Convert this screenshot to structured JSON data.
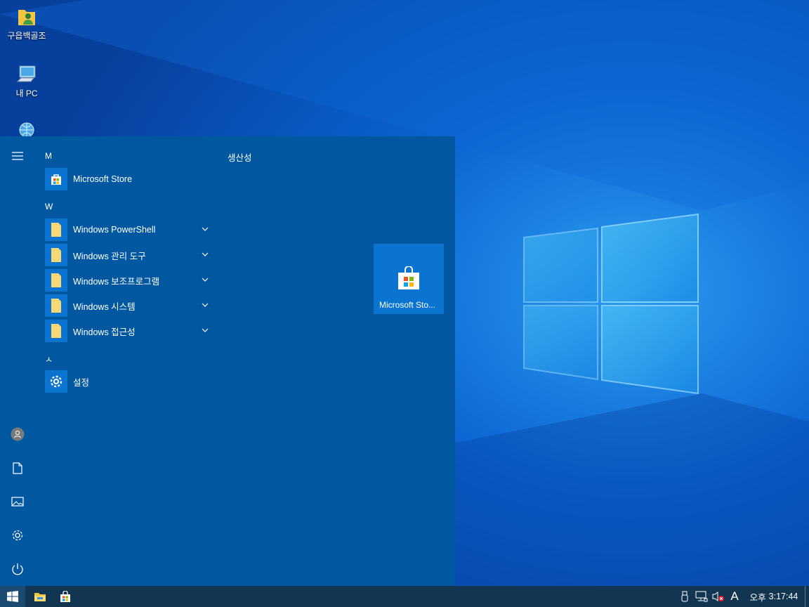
{
  "desktop": {
    "icons": [
      {
        "label": "구읍백골조",
        "icon": "user-folder-icon"
      },
      {
        "label": "내 PC",
        "icon": "computer-icon"
      },
      {
        "label": "",
        "icon": "network-globe-icon"
      }
    ]
  },
  "start_menu": {
    "groups": [
      {
        "letter": "M",
        "apps": [
          {
            "label": "Microsoft Store",
            "icon": "store-icon",
            "expandable": false
          }
        ]
      },
      {
        "letter": "W",
        "apps": [
          {
            "label": "Windows PowerShell",
            "icon": "folder-icon",
            "expandable": true
          },
          {
            "label": "Windows 관리 도구",
            "icon": "folder-icon",
            "expandable": true
          },
          {
            "label": "Windows 보조프로그램",
            "icon": "folder-icon",
            "expandable": true
          },
          {
            "label": "Windows 시스템",
            "icon": "folder-icon",
            "expandable": true
          },
          {
            "label": "Windows 접근성",
            "icon": "folder-icon",
            "expandable": true
          }
        ]
      },
      {
        "letter": "ㅅ",
        "apps": [
          {
            "label": "설정",
            "icon": "gear-icon",
            "expandable": false
          }
        ]
      }
    ],
    "tiles_header": "생산성",
    "tiles": [
      {
        "label": "Microsoft Sto...",
        "icon": "store-icon"
      }
    ],
    "rail": [
      "hamburger-icon",
      "user-icon",
      "document-icon",
      "pictures-icon",
      "settings-icon",
      "power-icon"
    ]
  },
  "taskbar": {
    "pinned": [
      "start-icon",
      "file-explorer-icon",
      "store-icon"
    ],
    "tray": {
      "ime": "A",
      "ampm": "오후",
      "time": "3:17:44"
    }
  },
  "colors": {
    "start_bg": "#0158a0",
    "tile_bg": "#0a74d0",
    "taskbar_bg": "#123652"
  }
}
